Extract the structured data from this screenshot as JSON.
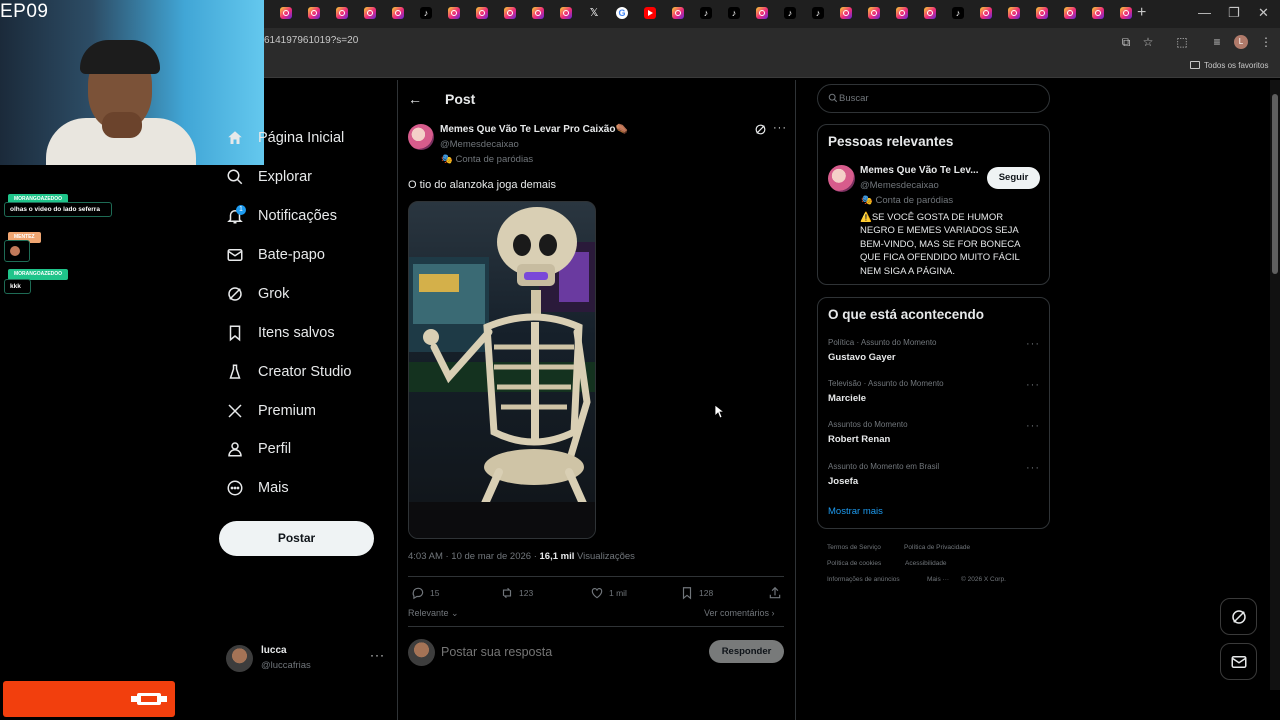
{
  "browser": {
    "url_fragment": "614197961019?s=20",
    "bookmark_folder": "Todos os favoritos",
    "profile_initial": "L",
    "tabs": [
      "instagram",
      "instagram",
      "instagram",
      "instagram",
      "instagram",
      "tiktok",
      "instagram",
      "instagram",
      "instagram",
      "instagram",
      "instagram",
      "x",
      "google",
      "youtube",
      "instagram",
      "tiktok",
      "tiktok",
      "instagram",
      "tiktok",
      "tiktok",
      "instagram",
      "instagram",
      "instagram",
      "instagram",
      "tiktok",
      "instagram",
      "instagram",
      "instagram",
      "instagram",
      "instagram",
      "instagram"
    ]
  },
  "stream": {
    "episode_label": "EP09",
    "chat": [
      {
        "user": "MORANGOAZEDOO",
        "message": "olhas o video do lado seferra",
        "badge_color": "#1fc48a"
      },
      {
        "user": "MENTEZ",
        "message": "",
        "badge_color": "#f0a672"
      },
      {
        "user": "MORANGOAZEDOO",
        "message": "kkk",
        "badge_color": "#1fc48a"
      }
    ]
  },
  "nav": {
    "items": [
      {
        "label": "Página Inicial",
        "icon": "home-icon"
      },
      {
        "label": "Explorar",
        "icon": "search-icon"
      },
      {
        "label": "Notificações",
        "icon": "bell-icon"
      },
      {
        "label": "Bate-papo",
        "icon": "mail-icon"
      },
      {
        "label": "Grok",
        "icon": "grok-icon"
      },
      {
        "label": "Itens salvos",
        "icon": "bookmark-icon"
      },
      {
        "label": "Creator Studio",
        "icon": "creator-studio-icon"
      },
      {
        "label": "Premium",
        "icon": "x-logo-icon"
      },
      {
        "label": "Perfil",
        "icon": "person-icon"
      },
      {
        "label": "Mais",
        "icon": "more-circle-icon"
      }
    ],
    "notification_count": "1",
    "post_button": "Postar",
    "account": {
      "name": "lucca",
      "handle": "@luccafrias"
    }
  },
  "post": {
    "header_title": "Post",
    "author": {
      "name": "Memes Que Vão Te Levar Pro Caixão⚰️",
      "handle": "@Memesdecaixao",
      "label": "Conta de paródias"
    },
    "text": "O tio do alanzoka joga demais",
    "time": "4:03 AM · 10 de mar de 2026 · ",
    "views": "16,1 mil",
    "views_label": " Visualizações",
    "stats": {
      "replies": "15",
      "reposts": "123",
      "likes": "1 mil",
      "bookmarks": "128"
    },
    "sort": "Relevante",
    "view_comments": "Ver comentários",
    "reply_placeholder": "Postar sua resposta",
    "reply_button": "Responder"
  },
  "sidebar": {
    "search_placeholder": "Buscar",
    "relevant": {
      "title": "Pessoas relevantes",
      "name": "Memes Que Vão Te Lev...",
      "handle": "@Memesdecaixao",
      "label": "Conta de paródias",
      "bio": "⚠️SE VOCÊ GOSTA DE HUMOR NEGRO E MEMES VARIADOS SEJA BEM-VINDO, MAS SE FOR BONECA QUE FICA OFENDIDO MUITO FÁCIL NEM SIGA A PÁGINA.",
      "follow": "Seguir"
    },
    "trends": {
      "title": "O que está acontecendo",
      "items": [
        {
          "meta": "Política · Assunto do Momento",
          "name": "Gustavo Gayer"
        },
        {
          "meta": "Televisão · Assunto do Momento",
          "name": "Marciele"
        },
        {
          "meta": "Assuntos do Momento",
          "name": "Robert Renan"
        },
        {
          "meta": "Assunto do Momento em Brasil",
          "name": "Josefa"
        }
      ],
      "show_more": "Mostrar mais"
    },
    "footer": [
      "Termos de Serviço",
      "Política de Privacidade",
      "Política de cookies",
      "Acessibilidade",
      "Informações de anúncios",
      "Mais ···",
      "© 2026 X Corp."
    ]
  },
  "colors": {
    "accent": "#1d9bf0",
    "background": "#000000",
    "border": "#2f3336",
    "muted_text": "#71767b",
    "widget": "#f23f0d"
  }
}
